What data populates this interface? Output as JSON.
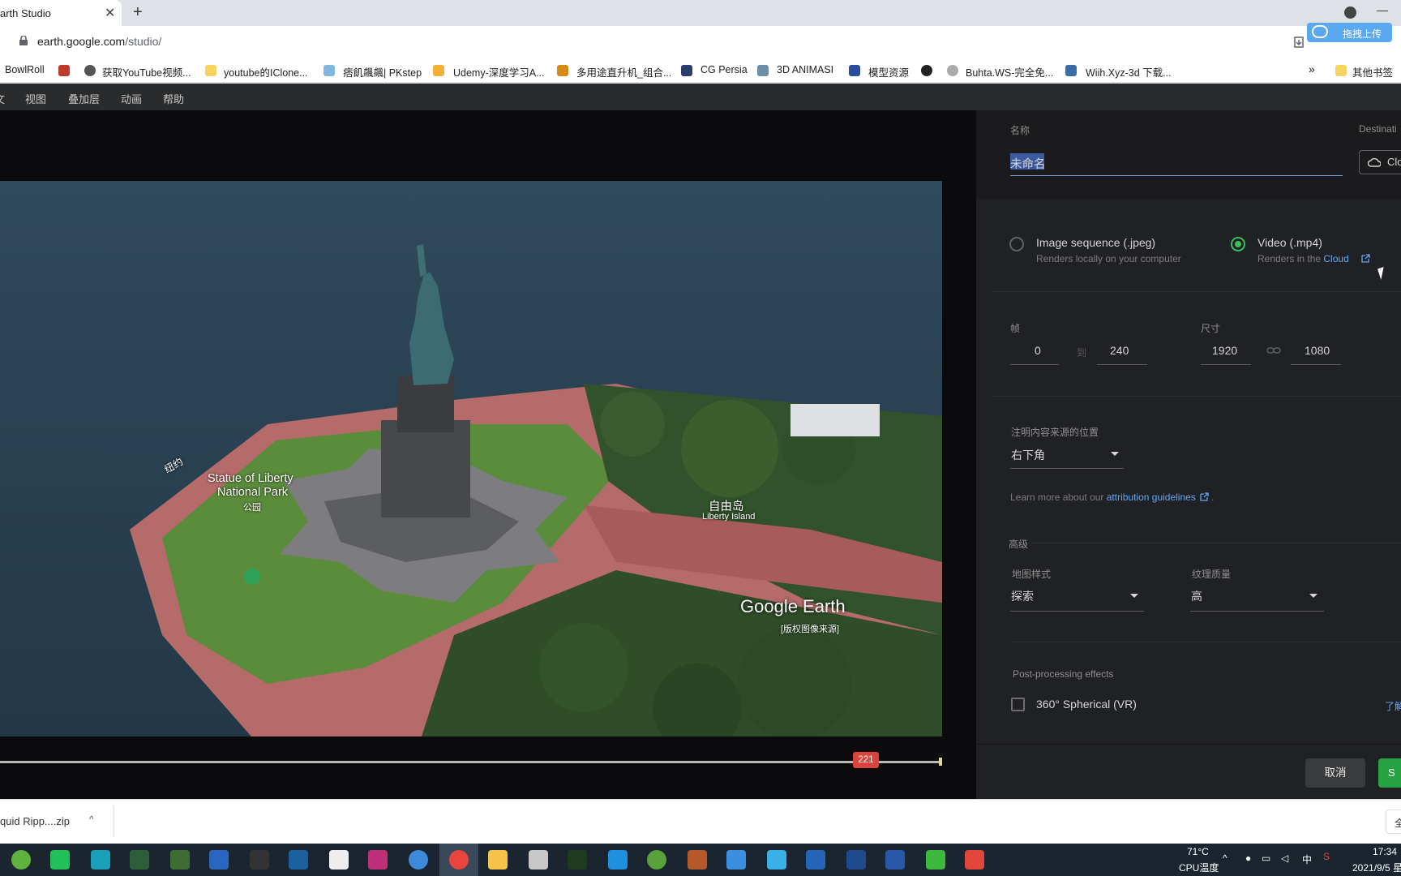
{
  "browser": {
    "tab_title": "arth Studio",
    "tab_close": "✕",
    "new_tab": "+",
    "url_host": "earth.google.com",
    "url_path": "/studio/",
    "upload_badge": "拖拽上传"
  },
  "bookmarks": [
    {
      "label": "BowlRoll"
    },
    {
      "label": "获取YouTube视频..."
    },
    {
      "label": "youtube的IClone..."
    },
    {
      "label": "痞飢飆飆| PKstep"
    },
    {
      "label": "Udemy-深度学习A..."
    },
    {
      "label": "多用途直升机_组合..."
    },
    {
      "label": "CG Persia"
    },
    {
      "label": "3D ANIMASI"
    },
    {
      "label": "模型资源"
    },
    {
      "label": "Buhta.WS-完全免..."
    },
    {
      "label": "Wiih.Xyz-3d 下载..."
    }
  ],
  "bookmarks_more": "»",
  "bookmarks_other": "其他书签",
  "menubar": {
    "items": [
      "视图",
      "叠加层",
      "动画",
      "帮助"
    ],
    "cut": "文"
  },
  "viewer": {
    "map_labels": {
      "statue": "Statue of Liberty",
      "park": "National Park",
      "park_type": "公园",
      "island_cn": "自由岛",
      "island_en": "Liberty Island",
      "newyork": "纽约"
    },
    "watermark": "Google Earth",
    "copyright": "[版权图像来源]",
    "current_frame": "221",
    "progress": 0.92
  },
  "render_panel": {
    "name_label": "名称",
    "name_value": "未命名",
    "destination_label": "Destinati",
    "destination_value": "Clo",
    "output": {
      "image_seq": {
        "label": "Image sequence (.jpeg)",
        "desc": "Renders locally on your computer",
        "selected": false
      },
      "video": {
        "label": "Video (.mp4)",
        "desc": "Renders in the",
        "desc_link": "Cloud",
        "selected": true
      }
    },
    "frames": {
      "label": "帧",
      "from": "0",
      "to_label": "到",
      "to": "240"
    },
    "dimensions": {
      "label": "尺寸",
      "width": "1920",
      "height": "1080"
    },
    "attribution": {
      "label": "注明内容来源的位置",
      "value": "右下角",
      "help": "Learn more about our",
      "help_link": "attribution guidelines",
      "help_end": "."
    },
    "advanced": {
      "label": "高级",
      "map_style_label": "地图样式",
      "map_style_value": "探索",
      "texture_label": "纹理质量",
      "texture_value": "高"
    },
    "post": {
      "label": "Post-processing effects",
      "vr_label": "360° Spherical (VR)",
      "vr_checked": false,
      "learn": "了解"
    },
    "cancel": "取消",
    "start": "S"
  },
  "downloads": {
    "item": "quid Ripp....zip",
    "chevron": "^",
    "show_all": "全"
  },
  "taskbar": {
    "temp": "71°C",
    "temp_label": "CPU温度",
    "ime": "中",
    "time": "17:34",
    "date": "2021/9/5 星"
  },
  "colors": {
    "accent_green": "#3fbf5b",
    "link_blue": "#64a7f4",
    "frame_marker": "#d9453d"
  }
}
